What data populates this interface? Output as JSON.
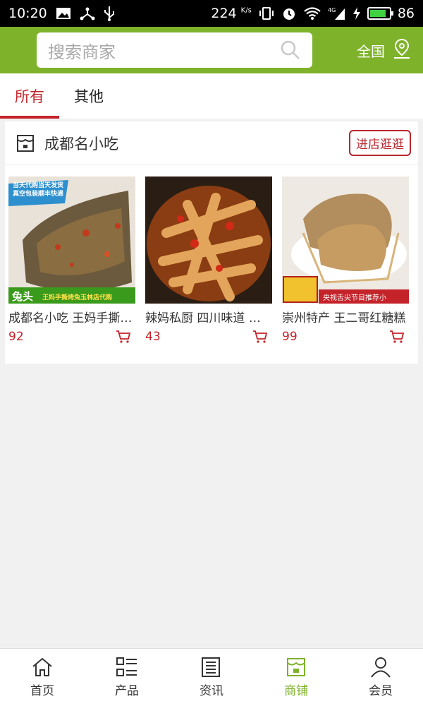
{
  "status_bar": {
    "time": "10:20",
    "speed": "224",
    "speed_unit": "K/s",
    "battery": "86",
    "battery_color": "#3fd13f"
  },
  "header": {
    "search_placeholder": "搜索商家",
    "region_label": "全国",
    "brand_color": "#7fb22b"
  },
  "tabs": [
    {
      "label": "所有",
      "active": true
    },
    {
      "label": "其他",
      "active": false
    }
  ],
  "shop": {
    "name": "成都名小吃",
    "visit_label": "进店逛逛",
    "products": [
      {
        "title": "成都名小吃 王妈手撕烤兔",
        "price": "92",
        "image_text_top": "当天代购当天发货 真空包装顺丰快递",
        "image_text_bottom": "兔头",
        "image_text_bottom2": "王妈手撕烤兔玉林店代购"
      },
      {
        "title": "辣妈私厨 四川味道 泡椒凤爪",
        "price": "43"
      },
      {
        "title": "崇州特产 王二哥红糖糕",
        "price": "99",
        "image_text_bottom": "央视舌尖节目推荐小"
      }
    ]
  },
  "bottom_nav": [
    {
      "label": "首页",
      "icon": "home-icon",
      "active": false
    },
    {
      "label": "产品",
      "icon": "list-icon",
      "active": false
    },
    {
      "label": "资讯",
      "icon": "news-icon",
      "active": false
    },
    {
      "label": "商铺",
      "icon": "store-icon",
      "active": true
    },
    {
      "label": "会员",
      "icon": "user-icon",
      "active": false
    }
  ],
  "colors": {
    "accent_red": "#c4232a",
    "nav_active": "#7fb22b"
  }
}
